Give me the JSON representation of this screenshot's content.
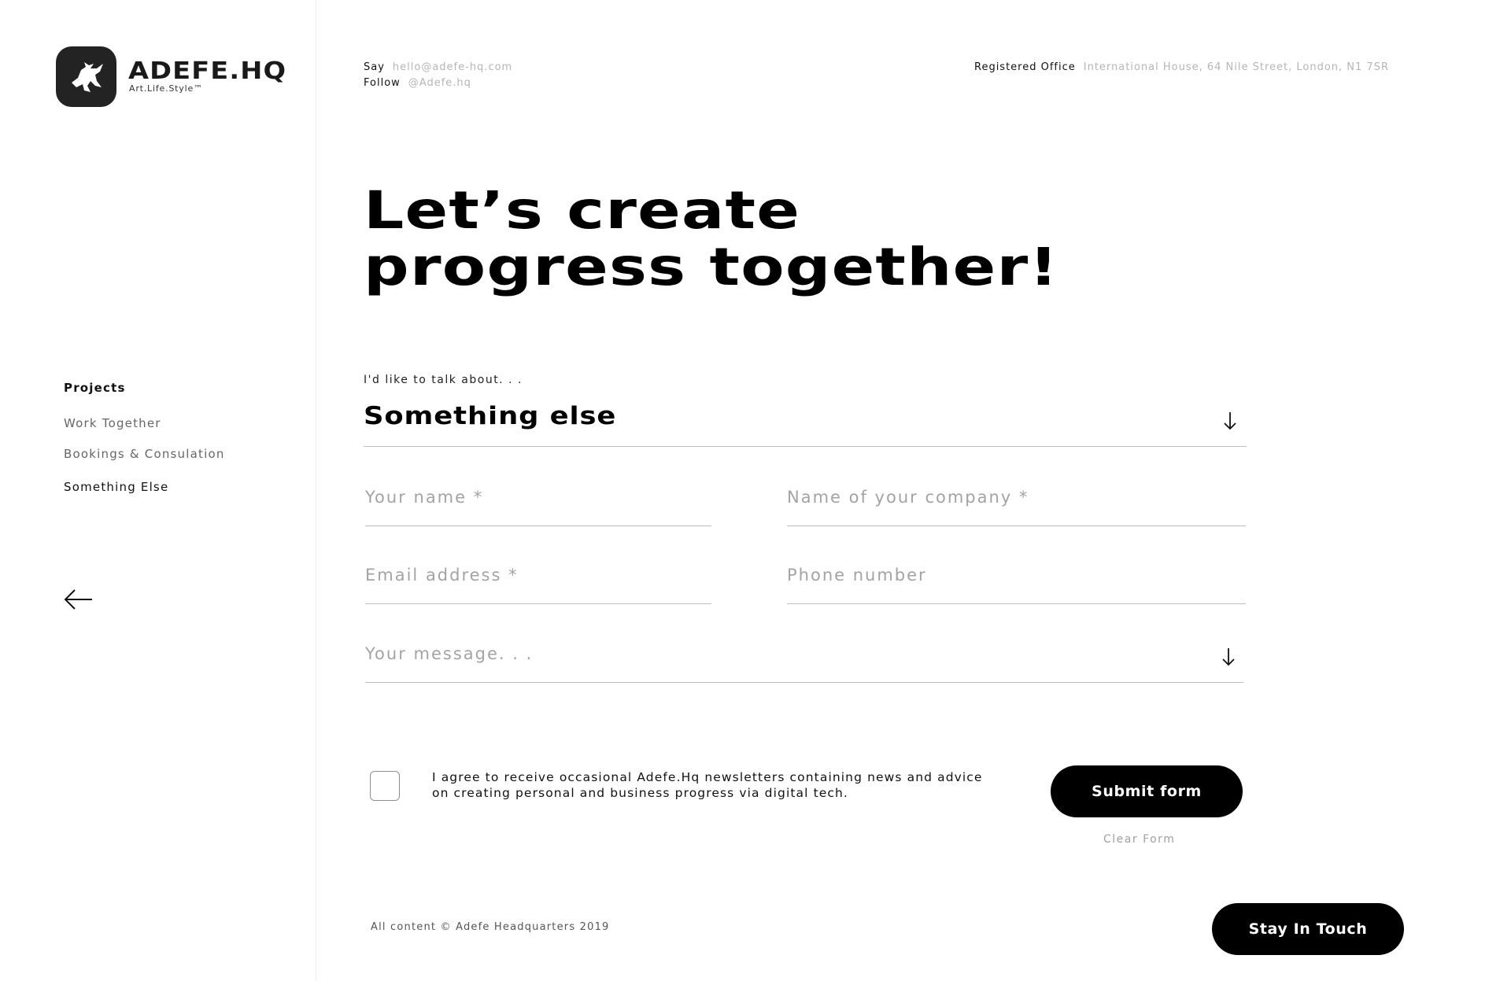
{
  "brand": {
    "name": "ADEFE.HQ",
    "tagline": "Art.Life.Style™",
    "logo_icon": "pegasus-icon"
  },
  "contact": {
    "say_label": "Say",
    "email": "hello@adefe-hq.com",
    "follow_label": "Follow",
    "handle": "@Adefe.hq",
    "office_label": "Registered Office",
    "office_address": "International House, 64 Nile Street, London, N1 7SR"
  },
  "sidebar": {
    "heading": "Projects",
    "items": [
      {
        "label": "Work Together"
      },
      {
        "label": "Bookings & Consulation"
      },
      {
        "label": "Something Else"
      }
    ],
    "back_icon": "arrow-left-icon"
  },
  "headline": {
    "line1": "Let’s create",
    "line2": "progress together!"
  },
  "form": {
    "topic_label": "I'd like to talk about. . .",
    "topic_value": "Something else",
    "name_placeholder": "Your name *",
    "company_placeholder": "Name of your company *",
    "email_placeholder": "Email address *",
    "phone_placeholder": "Phone number",
    "message_placeholder": "Your message. . .",
    "consent_text": "I agree to receive occasional Adefe.Hq newsletters containing news and advice on creating personal and business progress via digital tech.",
    "consent_checked": false,
    "submit_label": "Submit form",
    "clear_label": "Clear Form"
  },
  "footer": {
    "copyright": "All content © Adefe Headquarters 2019",
    "stay_label": "Stay In Touch"
  },
  "colors": {
    "primary": "#000000",
    "logo_bg": "#232323",
    "muted": "#a3a3a3",
    "background": "#ffffff"
  }
}
